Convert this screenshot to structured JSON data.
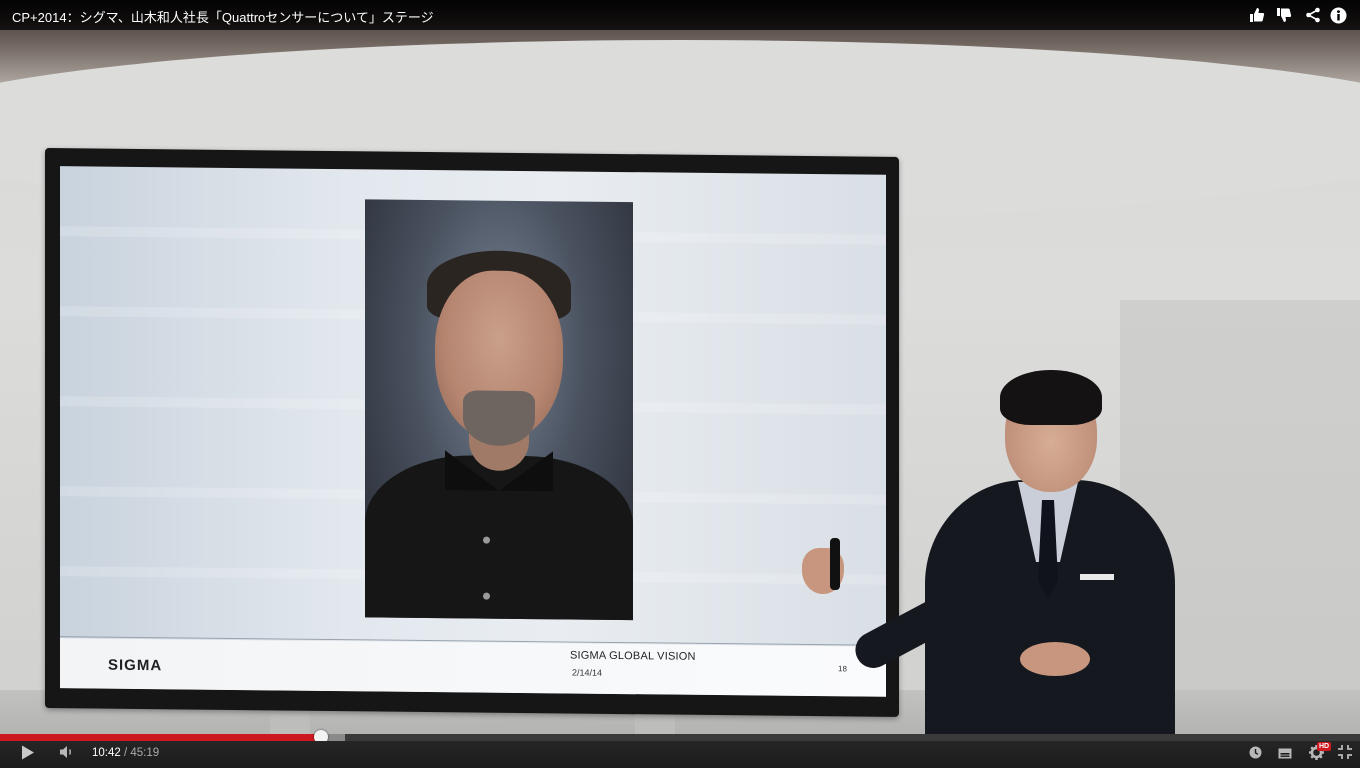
{
  "video": {
    "title": "CP+2014：シグマ、山木和人社長「Quattroセンサーについて」ステージ"
  },
  "top_actions": {
    "like_icon": "thumbs-up-icon",
    "dislike_icon": "thumbs-down-icon",
    "share_icon": "share-icon",
    "info_icon": "info-icon"
  },
  "slide": {
    "brand": "SIGMA",
    "footer_title": "SIGMA GLOBAL VISION",
    "date": "2/14/14",
    "page_number": "18"
  },
  "playback": {
    "current_time": "10:42",
    "separator": "/",
    "duration": "45:19",
    "played_fraction": 0.236,
    "buffered_fraction": 0.254
  },
  "controls": {
    "play_icon": "play-icon",
    "volume_icon": "volume-icon",
    "watch_later_icon": "clock-icon",
    "annotations_icon": "subtitles-icon",
    "settings_icon": "gear-icon",
    "quality_badge": "HD",
    "fullscreen_icon": "exit-fullscreen-icon"
  },
  "colors": {
    "progress_played": "#cc181e",
    "control_bar": "#1b1b1b",
    "hd_badge": "#cc181e"
  }
}
